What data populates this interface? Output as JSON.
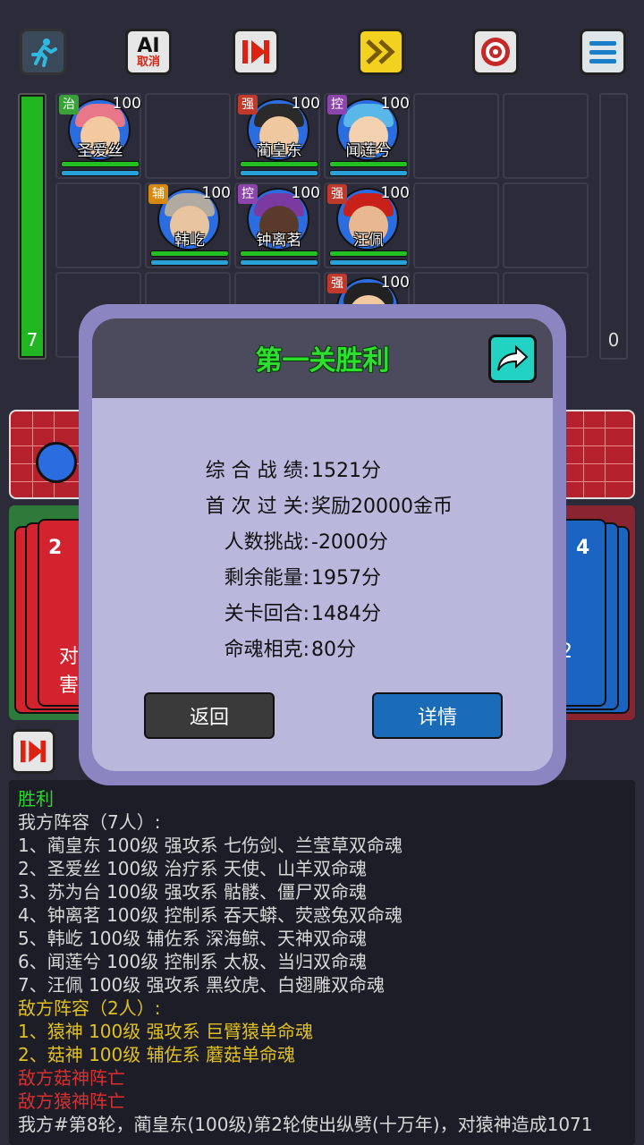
{
  "toolbar": {
    "ai_top": "AI",
    "ai_bottom": "取消"
  },
  "board": {
    "energy_left": "7",
    "energy_right": "0",
    "heroes": [
      {
        "name": "圣爱丝",
        "role": "治",
        "level": "100"
      },
      {
        "name": "蔺皇东",
        "role": "强",
        "level": "100"
      },
      {
        "name": "闻莲兮",
        "role": "控",
        "level": "100"
      },
      {
        "name": "韩屹",
        "role": "辅",
        "level": "100"
      },
      {
        "name": "钟离茗",
        "role": "控",
        "level": "100"
      },
      {
        "name": "汪佩",
        "role": "强",
        "level": "100"
      },
      {
        "name": "",
        "role": "强",
        "level": "100"
      }
    ]
  },
  "cards": {
    "left_count": "2",
    "right_count": "4",
    "left_text_1": "对",
    "left_text_2": "害",
    "right_text": "2"
  },
  "dialog": {
    "title": "第一关胜利",
    "stats": [
      {
        "label": "综 合 战 绩:",
        "value": "1521分"
      },
      {
        "label": "首 次 过 关:",
        "value": "奖励20000金币"
      },
      {
        "label": "人数挑战:",
        "value": "-2000分"
      },
      {
        "label": "剩余能量:",
        "value": "1957分"
      },
      {
        "label": "关卡回合:",
        "value": "1484分"
      },
      {
        "label": "命魂相克:",
        "value": "80分"
      }
    ],
    "back_label": "返回",
    "detail_label": "详情"
  },
  "log": [
    {
      "text": "胜利",
      "color": "green"
    },
    {
      "text": "我方阵容（7人）:",
      "color": "white"
    },
    {
      "text": "1、蔺皇东 100级 强攻系 七伤剑、兰莹草双命魂",
      "color": "white"
    },
    {
      "text": "2、圣爱丝 100级 治疗系 天使、山羊双命魂",
      "color": "white"
    },
    {
      "text": "3、苏为台 100级 强攻系 骷髅、僵尸双命魂",
      "color": "white"
    },
    {
      "text": "4、钟离茗 100级 控制系 吞天蟒、荧惑兔双命魂",
      "color": "white"
    },
    {
      "text": "5、韩屹 100级 辅佐系 深海鲸、天神双命魂",
      "color": "white"
    },
    {
      "text": "6、闻莲兮 100级 控制系 太极、当归双命魂",
      "color": "white"
    },
    {
      "text": "7、汪佩 100级 强攻系 黑纹虎、白翅雕双命魂",
      "color": "white"
    },
    {
      "text": "敌方阵容（2人）:",
      "color": "yellow"
    },
    {
      "text": "1、猿神 100级 强攻系 巨臂猿单命魂",
      "color": "yellow"
    },
    {
      "text": "2、菇神 100级 辅佐系 蘑菇单命魂",
      "color": "yellow"
    },
    {
      "text": "敌方菇神阵亡",
      "color": "red"
    },
    {
      "text": "敌方猿神阵亡",
      "color": "red"
    },
    {
      "text": "我方#第8轮，蔺皇东(100级)第2轮使出纵劈(十万年)，对猿神造成1071",
      "color": "white"
    }
  ]
}
